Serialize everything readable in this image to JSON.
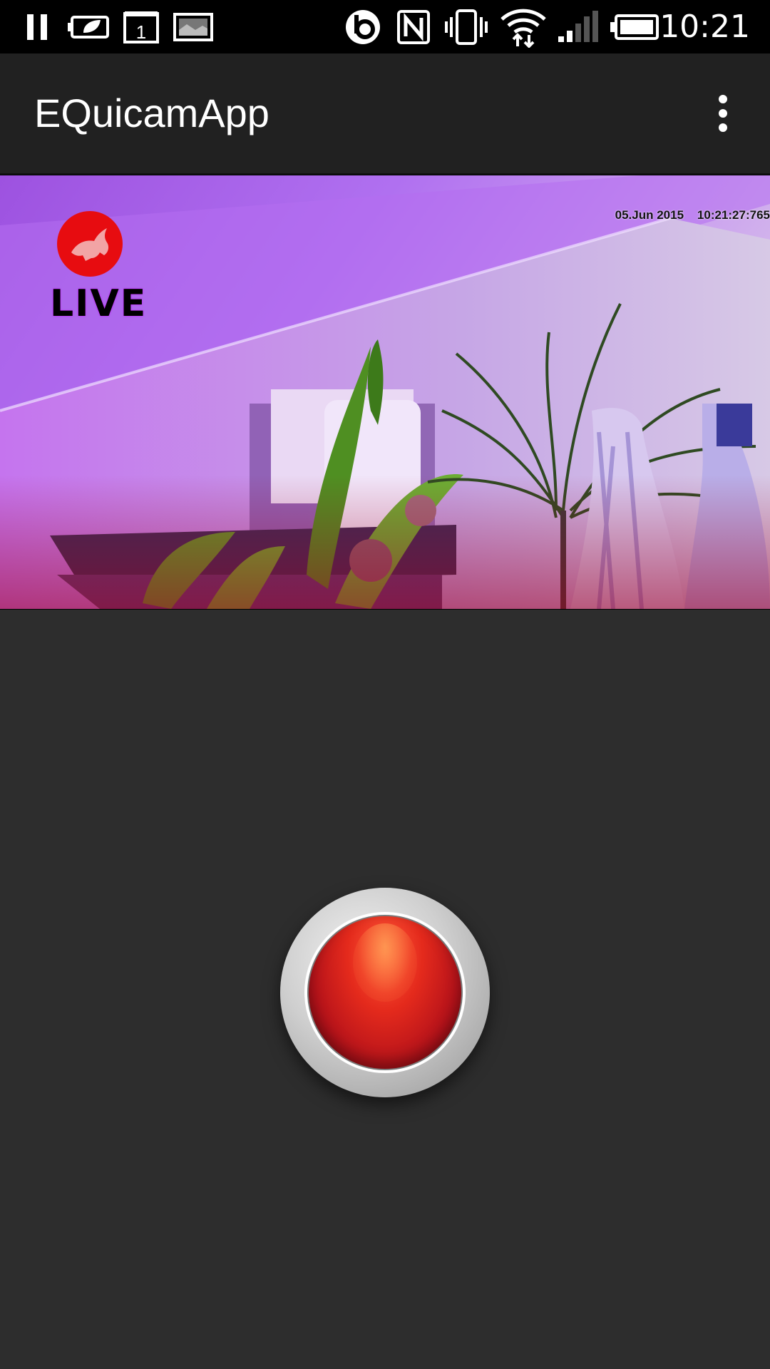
{
  "status_bar": {
    "time": "10:21",
    "left_icons": [
      "pause-icon",
      "battery-saver-leaf-icon",
      "calendar-icon",
      "gallery-icon"
    ],
    "right_icons": [
      "beats-audio-icon",
      "nfc-icon",
      "vibrate-icon",
      "wifi-icon",
      "signal-icon",
      "battery-icon"
    ],
    "calendar_day": "1"
  },
  "app_bar": {
    "title": "EQuicamApp",
    "overflow_icon": "more-vert-icon"
  },
  "camera_feed": {
    "live_label": "LIVE",
    "logo": "horse-logo",
    "timestamp": "05.Jun 2015    10:21:27:765",
    "colors": {
      "tint": "#b06cf0",
      "logo_red": "#e70c10"
    }
  },
  "record_button": {
    "name": "record",
    "colors": {
      "core": "#d41f1b",
      "bezel": "#c8c8c8"
    }
  }
}
